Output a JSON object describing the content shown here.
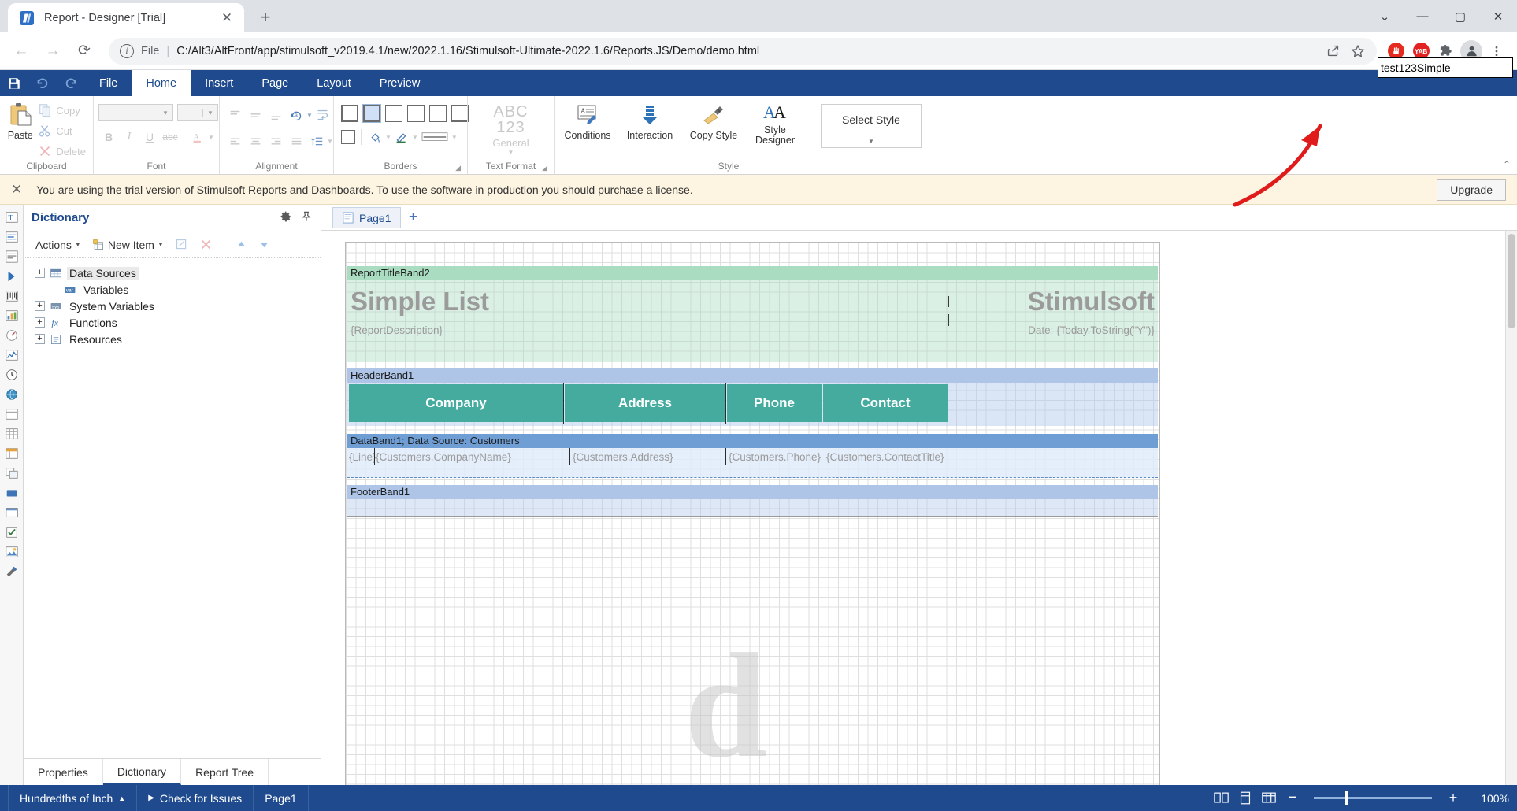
{
  "browser": {
    "tab": {
      "title": "Report - Designer [Trial]",
      "close_label": "✕"
    },
    "newtab_label": "+",
    "window": {
      "minimize": "―",
      "maximize": "▢",
      "close": "✕",
      "chevron": "⌄"
    },
    "nav": {
      "back": "←",
      "forward": "→",
      "reload": "⟳"
    },
    "omnibox": {
      "info_icon": "i",
      "scheme_label": "File",
      "separator": "|",
      "url": "C:/Alt3/AltFront/app/stimulsoft_v2019.4.1/new/2022.1.16/Stimulsoft-Ultimate-2022.1.6/Reports.JS/Demo/demo.html"
    },
    "extensions": [
      {
        "name": "share-icon",
        "glyph": "↗"
      },
      {
        "name": "bookmark-star-icon",
        "glyph": "☆"
      },
      {
        "name": "adblock-icon",
        "glyph": "✋"
      },
      {
        "name": "yab-extension-icon",
        "glyph": "YAB"
      },
      {
        "name": "extensions-puzzle-icon",
        "glyph": "🧩"
      },
      {
        "name": "profile-avatar",
        "glyph": "👤"
      },
      {
        "name": "chrome-menu-icon",
        "glyph": "⋮"
      }
    ]
  },
  "ribbon": {
    "quick_access": [
      {
        "name": "save-button",
        "glyph": "💾"
      },
      {
        "name": "undo-button",
        "glyph": "↺"
      },
      {
        "name": "redo-button",
        "glyph": "↻"
      }
    ],
    "tabs": [
      {
        "label": "File",
        "active": false
      },
      {
        "label": "Home",
        "active": true
      },
      {
        "label": "Insert",
        "active": false
      },
      {
        "label": "Page",
        "active": false
      },
      {
        "label": "Layout",
        "active": false
      },
      {
        "label": "Preview",
        "active": false
      }
    ],
    "name_input": {
      "value": "test123Simple",
      "placeholder": ""
    },
    "collapse_glyph": "⌃",
    "groups": {
      "clipboard": {
        "label": "Clipboard",
        "paste": "Paste",
        "copy": "Copy",
        "cut": "Cut",
        "delete": "Delete"
      },
      "font": {
        "label": "Font",
        "font_family_value": "",
        "font_size_value": "",
        "bold": "B",
        "italic": "I",
        "underline": "U",
        "strikeout": "abc",
        "text_color": "A"
      },
      "alignment": {
        "label": "Alignment"
      },
      "borders": {
        "label": "Borders"
      },
      "text_format": {
        "label": "Text Format",
        "sample_abc": "ABC",
        "sample_123": "123",
        "current": "General"
      },
      "style": {
        "label": "Style",
        "conditions": "Conditions",
        "interaction": "Interaction",
        "copy_style": "Copy Style",
        "style_designer": "Style\nDesigner",
        "style_designer_line1": "Style",
        "style_designer_line2": "Designer",
        "select_style": "Select Style"
      }
    }
  },
  "trial_bar": {
    "close_glyph": "✕",
    "message": "You are using the trial version of Stimulsoft Reports and Dashboards. To use the software in production you should purchase a license.",
    "upgrade_label": "Upgrade"
  },
  "left_strip": [
    {
      "name": "toolbox-text-icon",
      "glyph": "T"
    },
    {
      "name": "toolbox-text2-icon",
      "glyph": "T"
    },
    {
      "name": "toolbox-richtext-icon",
      "glyph": "▤"
    },
    {
      "name": "toolbox-image-icon",
      "glyph": "▶"
    },
    {
      "name": "toolbox-barcode-icon",
      "glyph": "▥"
    },
    {
      "name": "toolbox-chart-icon",
      "glyph": "◷"
    },
    {
      "name": "toolbox-gauge-icon",
      "glyph": "◔"
    },
    {
      "name": "toolbox-sparkline-icon",
      "glyph": "▮"
    },
    {
      "name": "toolbox-clock-icon",
      "glyph": "◕"
    },
    {
      "name": "toolbox-map-icon",
      "glyph": "◉"
    },
    {
      "name": "toolbox-panel-icon",
      "glyph": "▤"
    },
    {
      "name": "toolbox-table-icon",
      "glyph": "▦"
    },
    {
      "name": "toolbox-crosstab-icon",
      "glyph": "▣"
    },
    {
      "name": "toolbox-subreport-icon",
      "glyph": "▧"
    },
    {
      "name": "toolbox-shape-icon",
      "glyph": "▭"
    },
    {
      "name": "toolbox-rect-icon",
      "glyph": "▬"
    },
    {
      "name": "toolbox-checkbox-icon",
      "glyph": "☑"
    },
    {
      "name": "toolbox-picture-icon",
      "glyph": "🖼"
    },
    {
      "name": "toolbox-tools-icon",
      "glyph": "🛠"
    }
  ],
  "dictionary": {
    "title": "Dictionary",
    "header_icons": [
      {
        "name": "dictionary-settings-icon",
        "glyph": "⚙"
      },
      {
        "name": "dictionary-pin-icon",
        "glyph": "📌"
      }
    ],
    "toolbar": {
      "actions": "Actions",
      "new_item": "New Item",
      "edit_icon": "✎",
      "delete_icon": "✕",
      "move_up_icon": "▲",
      "move_down_icon": "▼"
    },
    "tree": [
      {
        "label": "Data Sources",
        "expandable": true,
        "expander": "+",
        "icon": "datasource-icon",
        "selected": true
      },
      {
        "label": "Variables",
        "expandable": false,
        "expander": "",
        "icon": "variables-icon",
        "selected": false
      },
      {
        "label": "System Variables",
        "expandable": true,
        "expander": "+",
        "icon": "system-variables-icon",
        "selected": false
      },
      {
        "label": "Functions",
        "expandable": true,
        "expander": "+",
        "icon": "functions-icon",
        "selected": false
      },
      {
        "label": "Resources",
        "expandable": true,
        "expander": "+",
        "icon": "resources-icon",
        "selected": false
      }
    ],
    "bottom_tabs": [
      {
        "label": "Properties",
        "active": false
      },
      {
        "label": "Dictionary",
        "active": true
      },
      {
        "label": "Report Tree",
        "active": false
      }
    ]
  },
  "designer": {
    "page_tabs": [
      {
        "label": "Page1",
        "active": true
      }
    ],
    "add_page_glyph": "+",
    "report": {
      "watermark": "d",
      "bands": [
        {
          "name": "ReportTitleBand2",
          "label": "ReportTitleBand2",
          "type": "title",
          "components": [
            {
              "name": "report-title-text",
              "text": "Simple List"
            },
            {
              "name": "company-name-text",
              "text": "Stimulsoft"
            },
            {
              "name": "report-description-text",
              "text": "{ReportDescription}"
            },
            {
              "name": "date-text",
              "text": "Date: {Today.ToString(\"Y\")}"
            }
          ]
        },
        {
          "name": "HeaderBand1",
          "label": "HeaderBand1",
          "type": "header",
          "columns": [
            "Company",
            "Address",
            "Phone",
            "Contact"
          ]
        },
        {
          "name": "DataBand1",
          "label": "DataBand1; Data Source: Customers",
          "type": "data",
          "components": [
            {
              "name": "line-number-text",
              "text": "{Line}"
            },
            {
              "name": "company-name-expression",
              "text": "{Customers.CompanyName}"
            },
            {
              "name": "address-expression",
              "text": "{Customers.Address}"
            },
            {
              "name": "phone-expression",
              "text": "{Customers.Phone}"
            },
            {
              "name": "contact-title-expression",
              "text": "{Customers.ContactTitle}"
            }
          ]
        },
        {
          "name": "FooterBand1",
          "label": "FooterBand1",
          "type": "footer",
          "components": []
        }
      ]
    }
  },
  "status_bar": {
    "units": "Hundredths of Inch",
    "units_caret": "▲",
    "check_issues": "Check for Issues",
    "check_issues_glyph": "▶",
    "page": "Page1",
    "view_icons": [
      {
        "name": "view-pages-icon",
        "glyph": "▦"
      },
      {
        "name": "view-single-page-icon",
        "glyph": "▤"
      },
      {
        "name": "view-thumbnails-icon",
        "glyph": "▥"
      }
    ],
    "zoom_out": "−",
    "zoom_in": "+",
    "zoom_value": "100%"
  },
  "colors": {
    "ribbon_blue": "#1f4b8e",
    "header_teal": "#44ab9e",
    "title_band_green": "#a9dcc0",
    "header_band_blue": "#aec5e8",
    "data_band_blue": "#6f9ed4",
    "trial_bg": "#fdf5e2",
    "annotation_red": "#e01b1b"
  }
}
